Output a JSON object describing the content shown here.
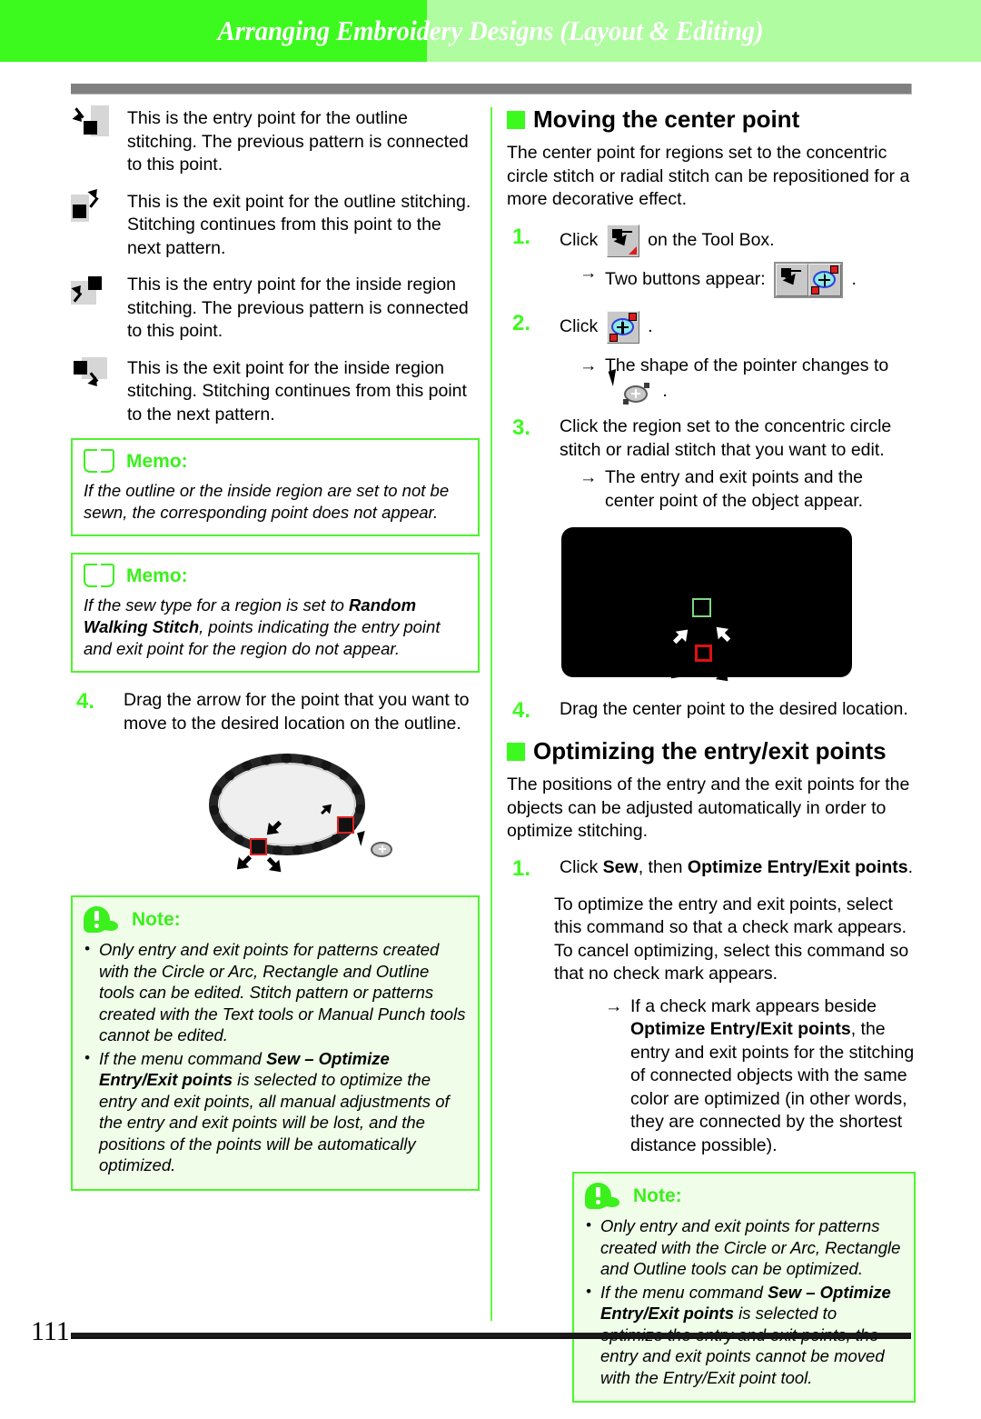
{
  "header": {
    "title": "Arranging Embroidery Designs (Layout & Editing)"
  },
  "footer": {
    "page_number": "111"
  },
  "colors": {
    "accent_green": "#3dfa1e",
    "header_light_green": "#b0fca0",
    "note_bg": "#effde9",
    "alert_red": "#e01010",
    "center_point_green": "#7fd77f"
  },
  "left_column": {
    "definitions": [
      {
        "icon": "entry-point-outline-icon",
        "text": "This is the entry point for the outline stitching. The previous pattern is connected to this point."
      },
      {
        "icon": "exit-point-outline-icon",
        "text": "This is the exit point for the outline stitching. Stitching continues from this point to the next pattern."
      },
      {
        "icon": "entry-point-inside-icon",
        "text": "This is the entry point for the inside region stitching. The previous pattern is connected to this point."
      },
      {
        "icon": "exit-point-inside-icon",
        "text": "This is the exit point for the inside region stitching. Stitching continues from this point to the next pattern."
      }
    ],
    "memo1": {
      "label": "Memo:",
      "icon": "book-icon",
      "body": "If the outline or the inside region are set to not be sewn, the corresponding point does not appear."
    },
    "memo2": {
      "label": "Memo:",
      "icon": "book-icon",
      "body_part1": "If the sew type for a region is set to ",
      "body_bold": "Random Walking Stitch",
      "body_part2": ", points indicating the entry point and exit point for the region do not appear."
    },
    "step4": {
      "num": "4.",
      "text": "Drag the arrow for the point that you want to move to the desired location on the outline."
    },
    "figure_ellipse": {
      "name": "outline-ellipse-with-entry-exit-points"
    },
    "note": {
      "label": "Note:",
      "icon": "exclamation-icon",
      "bullet1": "Only entry and exit points for patterns created with the Circle or Arc, Rectangle and Outline tools can be edited. Stitch pattern or patterns created with the Text tools or Manual Punch tools cannot be edited.",
      "bullet2_part1": "If the menu command ",
      "bullet2_bold": "Sew – Optimize Entry/Exit points",
      "bullet2_part2": " is selected to optimize the entry and exit points, all manual adjustments of the entry and exit points will be lost, and the positions of the points will be automatically optimized."
    }
  },
  "right_column": {
    "section1": {
      "heading": "Moving the center point",
      "intro": "The center point for regions set to the concentric circle stitch or radial stitch can be repositioned for a more decorative effect.",
      "step1": {
        "num": "1.",
        "text_before": "Click",
        "text_after": "on the Tool Box.",
        "icon": "entry-exit-point-tool-icon"
      },
      "step1_result": {
        "arrow": "→",
        "text": "Two buttons appear:",
        "icons": [
          "entry-exit-point-tool-icon",
          "center-point-tool-icon"
        ],
        "trailing": "."
      },
      "step2": {
        "num": "2.",
        "text_before": "Click",
        "icon": "center-point-tool-icon",
        "trailing": "."
      },
      "step2_result": {
        "arrow": "→",
        "text": "The shape of the pointer changes to",
        "icon": "center-point-pointer-icon",
        "trailing": "."
      },
      "step3": {
        "num": "3.",
        "text": "Click the region set to the concentric circle stitch or radial stitch that you want to edit."
      },
      "step3_result": {
        "arrow": "→",
        "text": "The entry and exit points and the center point of the object appear."
      },
      "figure_black": {
        "name": "design-canvas-with-center-point"
      },
      "step4": {
        "num": "4.",
        "text": "Drag the center point to the desired location."
      }
    },
    "section2": {
      "heading": "Optimizing the entry/exit points",
      "intro": "The positions of the entry and the exit points for the objects can be adjusted automatically in order to optimize stitching.",
      "step1": {
        "num": "1.",
        "text_before": "Click ",
        "bold1": "Sew",
        "text_mid": ", then ",
        "bold2": "Optimize Entry/Exit points",
        "text_after": "."
      },
      "body": "To optimize the entry and exit points, select this command so that a check mark appears. To cancel optimizing, select this command so that no check mark appears.",
      "result": {
        "arrow": "→",
        "part1": "If a check mark appears beside ",
        "bold": "Optimize Entry/Exit points",
        "part2": ", the entry and exit points for the stitching of connected objects with the same color are optimized (in other words, they are connected by the shortest distance possible)."
      },
      "note": {
        "label": "Note:",
        "icon": "exclamation-icon",
        "bullet1": "Only entry and exit points for patterns created with the Circle or Arc, Rectangle and Outline tools can be optimized.",
        "bullet2_part1": "If the menu command ",
        "bullet2_bold": "Sew – Optimize Entry/Exit points",
        "bullet2_part2": " is selected to optimize the entry and exit points, the entry and exit points cannot be moved with the Entry/Exit point tool."
      }
    }
  }
}
